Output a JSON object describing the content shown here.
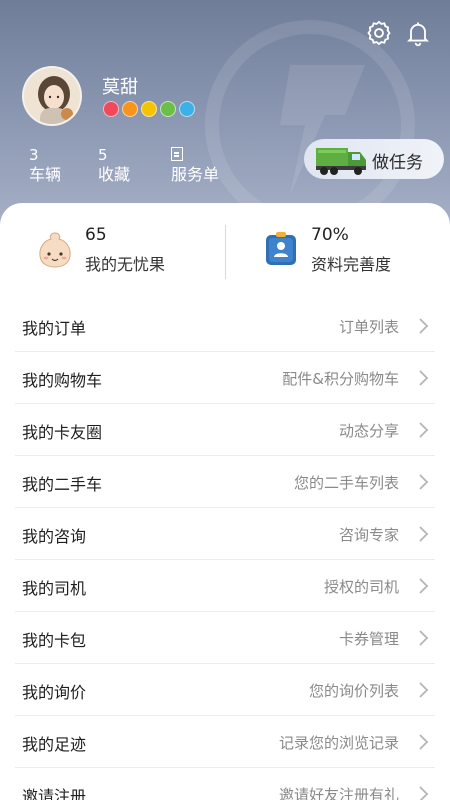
{
  "header": {
    "username": "莫甜",
    "badge_colors": [
      "#f04a5a",
      "#f7941d",
      "#f5c400",
      "#6cc04a",
      "#3db0e6"
    ],
    "stats": [
      {
        "value": "3",
        "label": "车辆"
      },
      {
        "value": "5",
        "label": "收藏"
      },
      {
        "value": "",
        "label": "服务单"
      }
    ],
    "task_button": "做任务"
  },
  "summary": {
    "left": {
      "value": "65",
      "label": "我的无忧果"
    },
    "right": {
      "value": "70%",
      "label": "资料完善度"
    }
  },
  "menu": [
    {
      "title": "我的订单",
      "sub": "订单列表"
    },
    {
      "title": "我的购物车",
      "sub": "配件&积分购物车"
    },
    {
      "title": "我的卡友圈",
      "sub": "动态分享"
    },
    {
      "title": "我的二手车",
      "sub": "您的二手车列表"
    },
    {
      "title": "我的咨询",
      "sub": "咨询专家"
    },
    {
      "title": "我的司机",
      "sub": "授权的司机"
    },
    {
      "title": "我的卡包",
      "sub": "卡券管理"
    },
    {
      "title": "我的询价",
      "sub": "您的询价列表"
    },
    {
      "title": "我的足迹",
      "sub": "记录您的浏览记录"
    },
    {
      "title": "邀请注册",
      "sub": "邀请好友注册有礼"
    }
  ],
  "colors": {
    "accent": "#2f6fb4",
    "header": "#7f8ca8"
  }
}
